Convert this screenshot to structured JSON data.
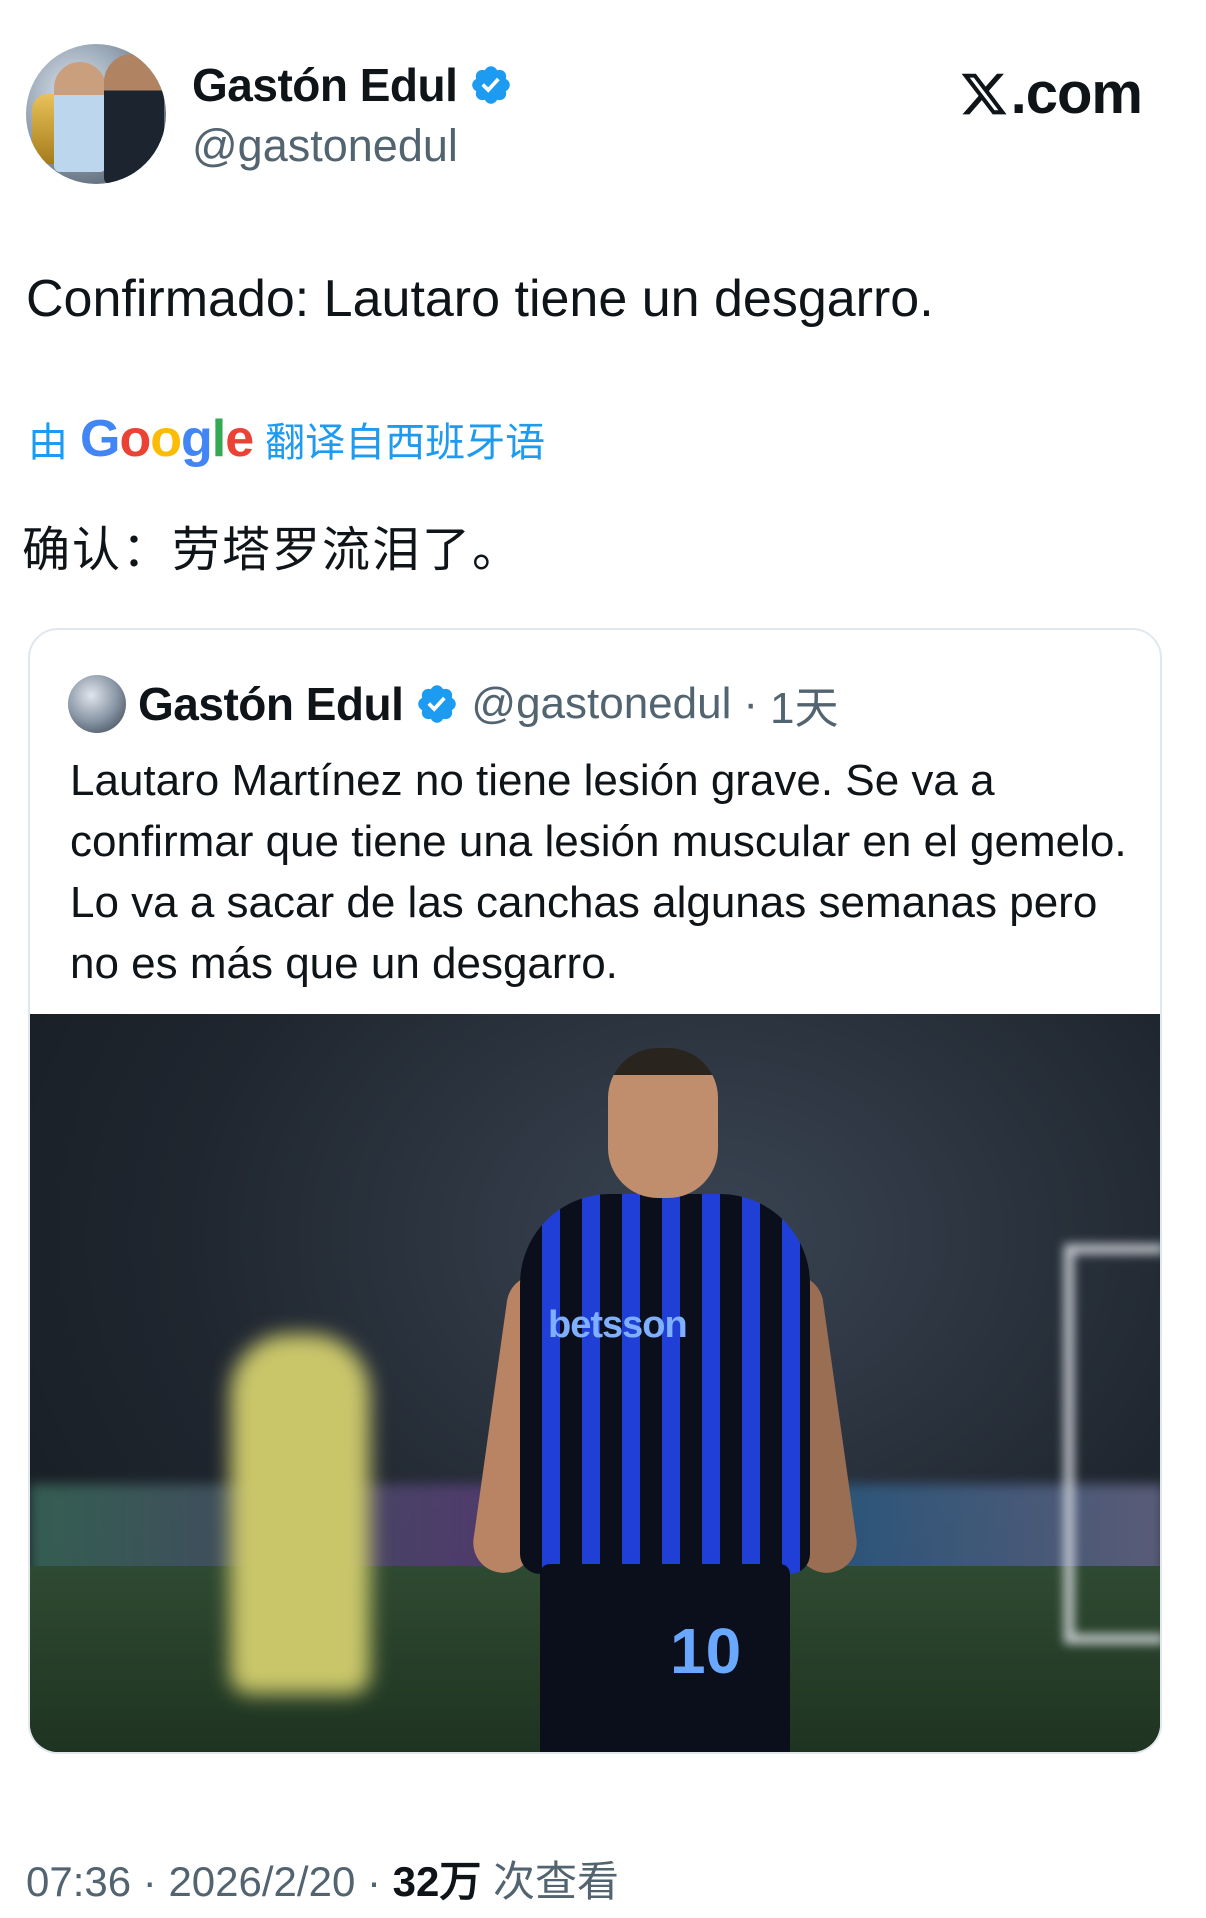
{
  "author": {
    "name": "Gastón Edul",
    "handle": "@gastonedul"
  },
  "site": {
    "name": ".com"
  },
  "tweet": {
    "text": "Confirmado: Lautaro tiene un desgarro."
  },
  "translation": {
    "prefix": "由",
    "provider": "Google",
    "suffix": "翻译自西班牙语",
    "text": "确认：劳塔罗流泪了。"
  },
  "quoted": {
    "name": "Gastón Edul",
    "handle": "@gastonedul",
    "sep": "·",
    "time": "1天",
    "text": "Lautaro Martínez no tiene lesión grave. Se va a confirmar que tiene una lesión muscular en el gemelo. Lo va a sacar de las canchas algunas semanas pero no es más que un desgarro.",
    "image": {
      "sponsor": "betsson",
      "number": "10"
    }
  },
  "meta": {
    "time": "07:36",
    "sep1": "·",
    "date": "2026/2/20",
    "sep2": "·",
    "views": "32万",
    "views_label": "次查看"
  },
  "colors": {
    "accent": "#1d9bf0",
    "text": "#0f1419",
    "secondary": "#536471"
  },
  "icons": {
    "verified": "verified-badge-icon",
    "x_logo": "x-logo-icon"
  }
}
